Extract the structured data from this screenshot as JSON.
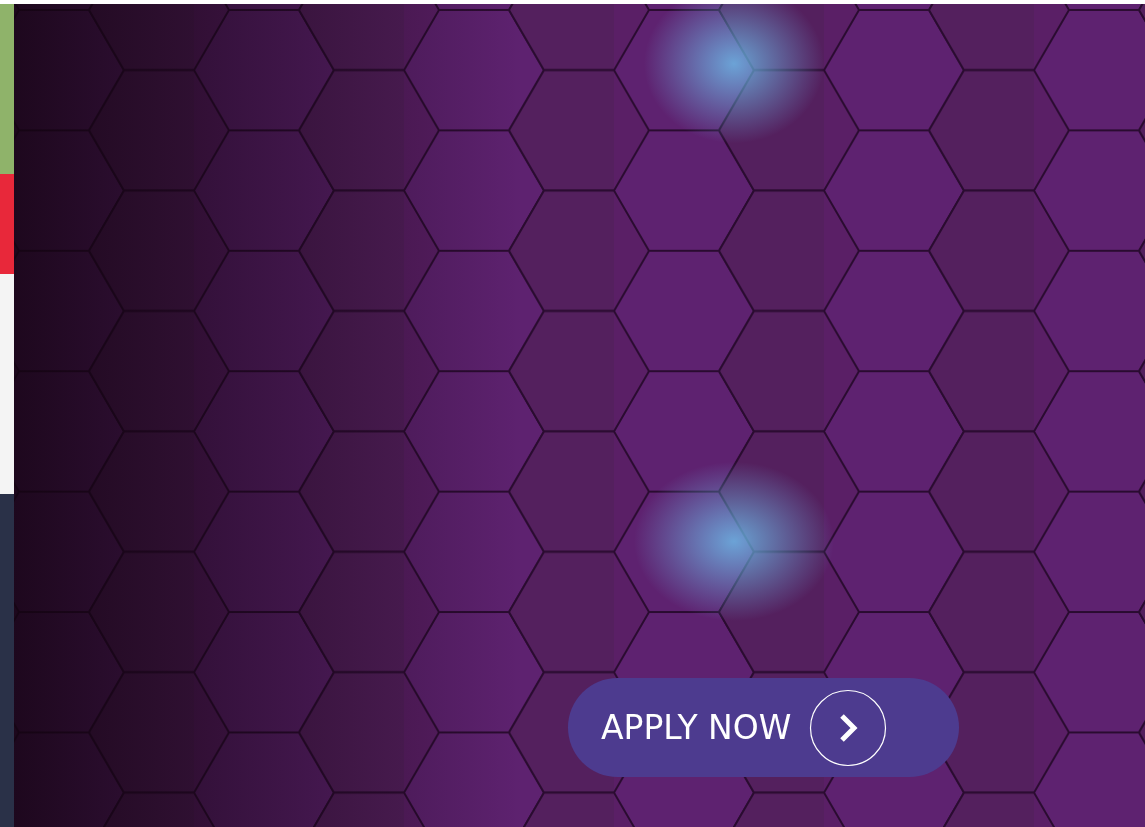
{
  "cta_button": {
    "label": "APPLY NOW"
  }
}
